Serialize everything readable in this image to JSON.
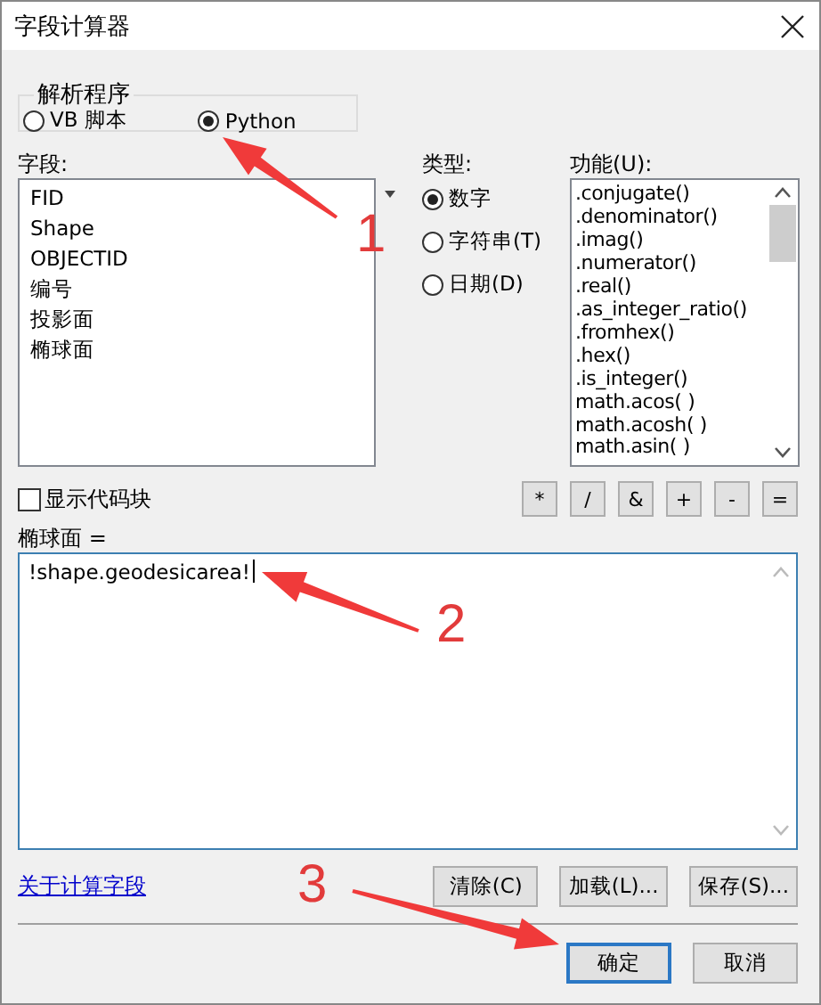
{
  "window": {
    "title": "字段计算器"
  },
  "parser": {
    "label": "解析程序",
    "options": [
      {
        "label": "VB 脚本",
        "selected": false
      },
      {
        "label": "Python",
        "selected": true
      }
    ]
  },
  "fields": {
    "label": "字段:",
    "items": [
      "FID",
      "Shape",
      "OBJECTID",
      "编号",
      "投影面",
      "椭球面"
    ]
  },
  "type": {
    "label": "类型:",
    "options": [
      {
        "label": "数字",
        "selected": true
      },
      {
        "label": "字符串(T)",
        "selected": false
      },
      {
        "label": "日期(D)",
        "selected": false
      }
    ]
  },
  "functions": {
    "label": "功能(U):",
    "items": [
      ".conjugate()",
      ".denominator()",
      ".imag()",
      ".numerator()",
      ".real()",
      ".as_integer_ratio()",
      ".fromhex()",
      ".hex()",
      ".is_integer()",
      "math.acos( )",
      "math.acosh( )",
      "math.asin( )"
    ]
  },
  "show_codeblock": {
    "label": "显示代码块",
    "checked": false
  },
  "operators": [
    "*",
    "/",
    "&",
    "+",
    "-",
    "="
  ],
  "expression": {
    "label": "椭球面 =",
    "value": "!shape.geodesicarea!"
  },
  "help_link": "关于计算字段",
  "buttons": [
    {
      "label": "清除(C)"
    },
    {
      "label": "加载(L)..."
    },
    {
      "label": "保存(S)..."
    }
  ],
  "dialog_buttons": [
    {
      "label": "确定",
      "default": true
    },
    {
      "label": "取消",
      "default": false
    }
  ],
  "annotations": [
    {
      "number": "1"
    },
    {
      "number": "2"
    },
    {
      "number": "3"
    }
  ]
}
